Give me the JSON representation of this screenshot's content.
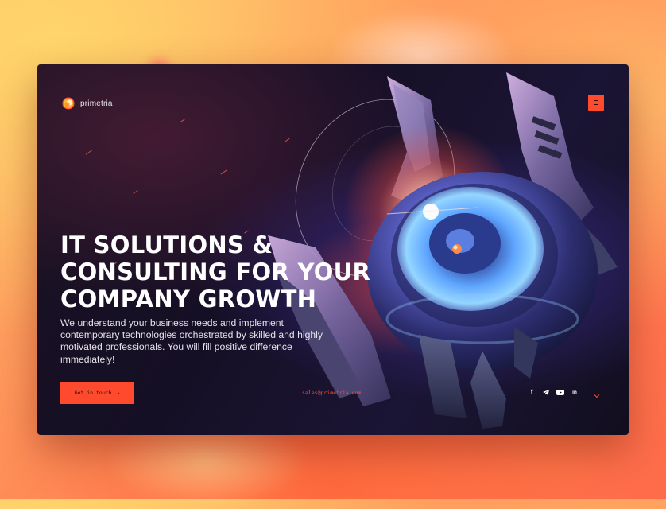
{
  "brand": {
    "name": "primetria",
    "logo_icon": "sun-ring-icon",
    "accent": "#ff4a2e"
  },
  "header": {
    "menu_icon": "hamburger-menu-icon"
  },
  "hero": {
    "headline_lines": [
      "IT SOLUTIONS &",
      "CONSULTING FOR YOUR",
      "COMPANY GROWTH"
    ],
    "description": "We understand your business needs and implement contemporary technologies orchestrated by skilled and highly motivated professionals. You will fill positive difference immediately!",
    "cta_label": "Get in touch",
    "cta_icon": "chevron-right-icon",
    "illustration": "robot-drone-illustration"
  },
  "footer": {
    "email": "sales@primetria.com",
    "socials": [
      {
        "name": "facebook",
        "glyph": "f",
        "icon": "facebook-icon"
      },
      {
        "name": "telegram",
        "icon": "telegram-icon"
      },
      {
        "name": "youtube",
        "icon": "youtube-icon"
      },
      {
        "name": "linkedin",
        "glyph": "in",
        "icon": "linkedin-icon"
      }
    ],
    "scroll_icon": "chevron-down-icon"
  },
  "colors": {
    "background_gradient": [
      "#ffbf6e",
      "#ff8a55",
      "#ff6b4a"
    ],
    "panel": "#150f25",
    "text_primary": "#ffffff",
    "accent": "#ff4a2e"
  }
}
